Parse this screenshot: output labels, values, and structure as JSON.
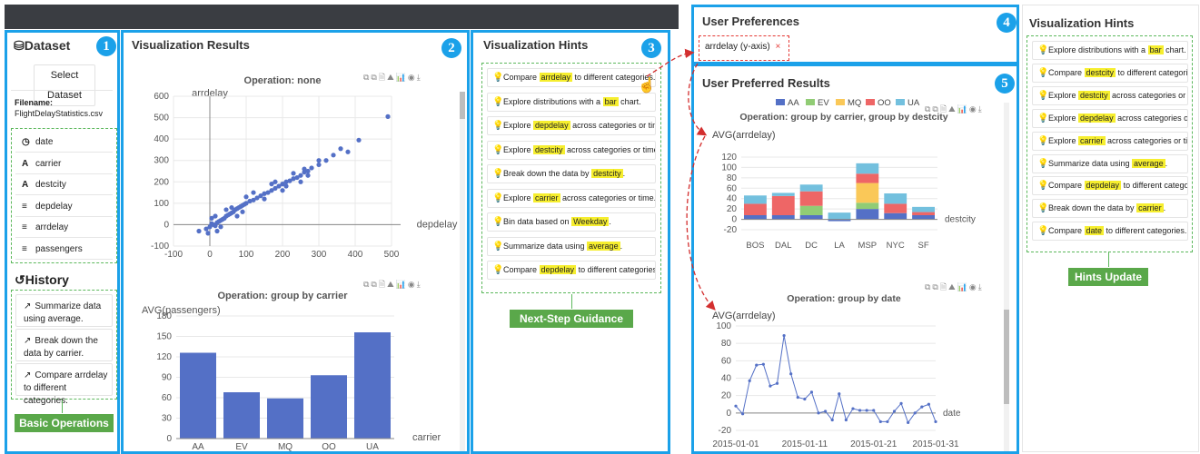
{
  "panels": {
    "dataset": {
      "num": "1",
      "title": "Dataset",
      "select_button": "Select Dataset",
      "filename_label": "Filename:",
      "filename": "FlightDelayStatistics.csv",
      "fields": [
        {
          "icon": "clock-icon",
          "glyph": "◷",
          "name": "date"
        },
        {
          "icon": "text-type-icon",
          "glyph": "A",
          "name": "carrier"
        },
        {
          "icon": "text-type-icon",
          "glyph": "A",
          "name": "destcity"
        },
        {
          "icon": "numeric-type-icon",
          "glyph": "≡",
          "name": "depdelay"
        },
        {
          "icon": "numeric-type-icon",
          "glyph": "≡",
          "name": "arrdelay"
        },
        {
          "icon": "numeric-type-icon",
          "glyph": "≡",
          "name": "passengers"
        }
      ],
      "history_title": "History",
      "history": [
        "Summarize data using average.",
        "Break down the data by carrier.",
        "Compare arrdelay to different categories."
      ],
      "badge": "Basic Operations"
    },
    "results": {
      "num": "2",
      "title": "Visualization Results"
    },
    "hints": {
      "num": "3",
      "title": "Visualization Hints",
      "badge": "Next-Step Guidance"
    },
    "preferences": {
      "num": "4",
      "title": "User Preferences",
      "tag": "arrdelay (y-axis)",
      "tag_close": "×"
    },
    "preferred": {
      "num": "5",
      "title": "User Preferred Results"
    },
    "hints_update": {
      "title": "Visualization Hints",
      "badge": "Hints Update"
    }
  },
  "hints_list": [
    {
      "pre": "Compare ",
      "hl": "arrdelay",
      "post": " to different categories."
    },
    {
      "pre": "Explore distributions with a ",
      "hl": "bar",
      "post": " chart."
    },
    {
      "pre": "Explore ",
      "hl": "depdelay",
      "post": " across categories or time."
    },
    {
      "pre": "Explore ",
      "hl": "destcity",
      "post": " across categories or time."
    },
    {
      "pre": "Break down the data by ",
      "hl": "destcity",
      "post": "."
    },
    {
      "pre": "Explore ",
      "hl": "carrier",
      "post": " across categories or time."
    },
    {
      "pre": "Bin data based on ",
      "hl": "Weekday",
      "post": "."
    },
    {
      "pre": "Summarize data using ",
      "hl": "average",
      "post": "."
    },
    {
      "pre": "Compare ",
      "hl": "depdelay",
      "post": " to different categories."
    }
  ],
  "hints_update_list": [
    {
      "pre": "Explore distributions with a ",
      "hl": "bar",
      "post": " chart."
    },
    {
      "pre": "Compare ",
      "hl": "destcity",
      "post": " to different categories."
    },
    {
      "pre": "Explore ",
      "hl": "destcity",
      "post": " across categories or time."
    },
    {
      "pre": "Explore ",
      "hl": "depdelay",
      "post": " across categories or time."
    },
    {
      "pre": "Explore ",
      "hl": "carrier",
      "post": " across categories or time."
    },
    {
      "pre": "Summarize data using ",
      "hl": "average",
      "post": "."
    },
    {
      "pre": "Compare ",
      "hl": "depdelay",
      "post": " to different categories."
    },
    {
      "pre": "Break down the data by ",
      "hl": "carrier",
      "post": "."
    },
    {
      "pre": "Compare ",
      "hl": "date",
      "post": " to different categories."
    }
  ],
  "toolbox": "⧉⧉🗎⛰📊◉⤓",
  "colors": {
    "accent": "#1ba1e9",
    "bar": "#5470c6",
    "badge": "#5aa84a",
    "highlight": "#f6ee2e",
    "tag": "#e53935"
  },
  "chart_data": [
    {
      "type": "scatter",
      "title": "Operation: none",
      "xlabel": "depdelay",
      "ylabel": "arrdelay",
      "xlim": [
        -100,
        500
      ],
      "ylim": [
        -100,
        600
      ],
      "xticks": [
        "-100",
        "0",
        "100",
        "200",
        "300",
        "400",
        "500"
      ],
      "yticks": [
        "-100",
        "0",
        "100",
        "200",
        "300",
        "400",
        "500",
        "600"
      ],
      "points": [
        [
          -10,
          -20
        ],
        [
          -5,
          -40
        ],
        [
          0,
          -10
        ],
        [
          5,
          5
        ],
        [
          10,
          0
        ],
        [
          15,
          -5
        ],
        [
          20,
          10
        ],
        [
          25,
          15
        ],
        [
          30,
          20
        ],
        [
          35,
          25
        ],
        [
          40,
          30
        ],
        [
          45,
          40
        ],
        [
          50,
          45
        ],
        [
          55,
          50
        ],
        [
          60,
          55
        ],
        [
          65,
          60
        ],
        [
          70,
          70
        ],
        [
          75,
          75
        ],
        [
          80,
          80
        ],
        [
          85,
          85
        ],
        [
          90,
          90
        ],
        [
          95,
          95
        ],
        [
          100,
          100
        ],
        [
          110,
          110
        ],
        [
          120,
          115
        ],
        [
          130,
          125
        ],
        [
          140,
          135
        ],
        [
          150,
          145
        ],
        [
          160,
          150
        ],
        [
          170,
          160
        ],
        [
          180,
          170
        ],
        [
          190,
          180
        ],
        [
          200,
          190
        ],
        [
          210,
          200
        ],
        [
          220,
          205
        ],
        [
          230,
          215
        ],
        [
          240,
          220
        ],
        [
          250,
          230
        ],
        [
          260,
          245
        ],
        [
          270,
          250
        ],
        [
          280,
          265
        ],
        [
          300,
          280
        ],
        [
          320,
          300
        ],
        [
          340,
          325
        ],
        [
          360,
          355
        ],
        [
          380,
          340
        ],
        [
          410,
          395
        ],
        [
          490,
          505
        ],
        [
          -30,
          -30
        ],
        [
          15,
          40
        ],
        [
          30,
          -10
        ],
        [
          60,
          80
        ],
        [
          90,
          60
        ],
        [
          120,
          150
        ],
        [
          150,
          120
        ],
        [
          180,
          200
        ],
        [
          200,
          160
        ],
        [
          230,
          240
        ],
        [
          250,
          200
        ],
        [
          270,
          230
        ],
        [
          100,
          130
        ],
        [
          75,
          40
        ],
        [
          45,
          70
        ],
        [
          20,
          -30
        ],
        [
          5,
          30
        ],
        [
          170,
          190
        ],
        [
          300,
          300
        ],
        [
          260,
          260
        ],
        [
          210,
          180
        ]
      ]
    },
    {
      "type": "bar",
      "title": "Operation: group by carrier",
      "xlabel": "carrier",
      "ylabel": "AVG(passengers)",
      "categories": [
        "AA",
        "EV",
        "MQ",
        "OO",
        "UA"
      ],
      "values": [
        126,
        68,
        59,
        93,
        156
      ],
      "ylim": [
        0,
        180
      ],
      "yticks": [
        "0",
        "30",
        "60",
        "90",
        "120",
        "150",
        "180"
      ]
    },
    {
      "type": "bar",
      "title": "Operation: group by carrier, group by destcity",
      "xlabel": "destcity",
      "ylabel": "AVG(arrdelay)",
      "categories": [
        "BOS",
        "DAL",
        "DC",
        "LA",
        "MSP",
        "NYC",
        "SF"
      ],
      "ylim": [
        -20,
        120
      ],
      "yticks": [
        "-20",
        "0",
        "20",
        "40",
        "60",
        "80",
        "100",
        "120"
      ],
      "series": [
        {
          "name": "AA",
          "color": "#5470c6",
          "values": [
            8,
            8,
            8,
            0,
            20,
            12,
            8
          ]
        },
        {
          "name": "EV",
          "color": "#91cc75",
          "values": [
            0,
            0,
            18,
            0,
            12,
            0,
            0
          ]
        },
        {
          "name": "MQ",
          "color": "#fac858",
          "values": [
            0,
            0,
            0,
            0,
            38,
            0,
            0
          ]
        },
        {
          "name": "OO",
          "color": "#ee6666",
          "values": [
            22,
            37,
            28,
            0,
            18,
            18,
            6
          ]
        },
        {
          "name": "UA",
          "color": "#73c0de",
          "values": [
            16,
            6,
            13,
            13,
            20,
            20,
            10
          ]
        }
      ]
    },
    {
      "type": "line",
      "title": "Operation: group by date",
      "xlabel": "date",
      "ylabel": "AVG(arrdelay)",
      "ylim": [
        -20,
        100
      ],
      "yticks": [
        "-20",
        "0",
        "20",
        "40",
        "60",
        "80",
        "100"
      ],
      "xticks": [
        "2015-01-01",
        "2015-01-11",
        "2015-01-21",
        "2015-01-31"
      ],
      "values": [
        8,
        -1,
        37,
        55,
        56,
        31,
        34,
        89,
        45,
        18,
        16,
        24,
        0,
        2,
        -8,
        22,
        -8,
        5,
        3,
        3,
        3,
        -10,
        -10,
        2,
        11,
        -11,
        0,
        7,
        10,
        -10
      ]
    }
  ]
}
